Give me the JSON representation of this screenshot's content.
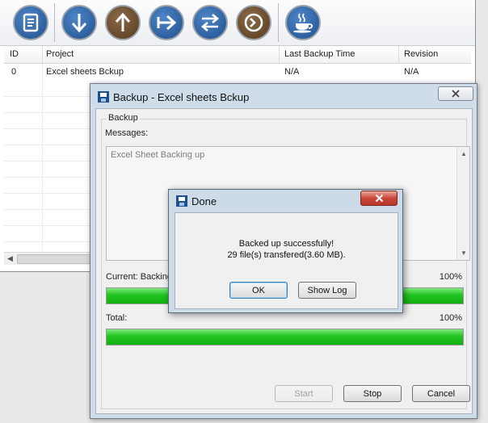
{
  "toolbar": {
    "buttons": [
      {
        "icon": "document-icon"
      },
      {
        "icon": "arrow-down-icon"
      },
      {
        "icon": "arrow-up-icon"
      },
      {
        "icon": "arrow-right-icon"
      },
      {
        "icon": "sync-arrows-icon"
      },
      {
        "icon": "clock-icon"
      },
      {
        "icon": "coffee-cup-icon"
      }
    ]
  },
  "table": {
    "columns": [
      "ID",
      "Project",
      "Last Backup Time",
      "Revision"
    ],
    "rows": [
      {
        "id": "0",
        "project": "Excel sheets Bckup",
        "last_backup": "N/A",
        "revision": "N/A"
      }
    ]
  },
  "backup_window": {
    "title": "Backup - Excel sheets Bckup",
    "group_label": "Backup",
    "messages_label": "Messages:",
    "message_text": "Excel Sheet Backing up",
    "current_label": "Current: Backing",
    "current_percent": "100%",
    "current_progress": 1.0,
    "total_label": "Total:",
    "total_percent": "100%",
    "total_progress": 1.0,
    "start_label": "Start",
    "stop_label": "Stop",
    "cancel_label": "Cancel"
  },
  "done_dialog": {
    "title": "Done",
    "line1": "Backed up successfully!",
    "line2": "29 file(s) transfered(3.60 MB).",
    "ok_label": "OK",
    "show_log_label": "Show Log"
  },
  "colors": {
    "progress_green": "#21c421",
    "toolbar_button_blue": "#2a5d9a",
    "toolbar_button_brown": "#6b4a2c",
    "close_button_red": "#c9473a"
  }
}
